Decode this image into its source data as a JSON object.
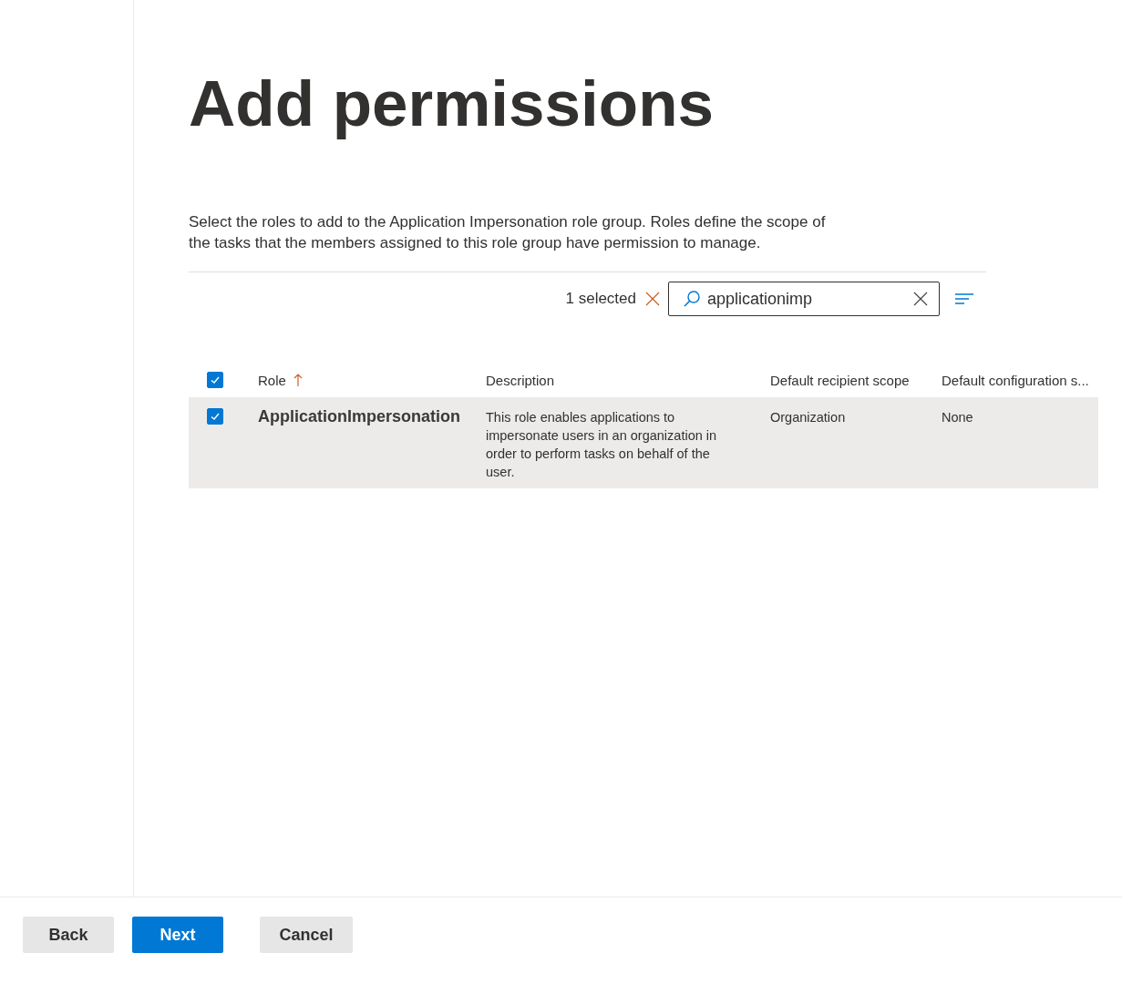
{
  "title": "Add permissions",
  "description": "Select the roles to add to the Application Impersonation role group. Roles define the scope of the tasks that the members assigned to this role group have permission to manage.",
  "toolbar": {
    "selection_count": "1 selected",
    "search": {
      "value": "applicationimp"
    }
  },
  "table": {
    "select_all": {
      "checked": true
    },
    "columns": [
      {
        "label": "Role",
        "sorted": true
      },
      {
        "label": "Description",
        "sorted": false
      },
      {
        "label": "Default recipient scope",
        "sorted": false
      },
      {
        "label": "Default configuration s...",
        "sorted": false
      }
    ],
    "rows": [
      {
        "selected": true,
        "checked": true,
        "cells": [
          "ApplicationImpersonation",
          "This role enables applications to impersonate users in an organization in order to perform tasks on behalf of the user.",
          "Organization",
          "None"
        ]
      }
    ]
  },
  "buttons": [
    {
      "label": "Back",
      "kind": "default"
    },
    {
      "label": "Next",
      "kind": "primary"
    },
    {
      "label": "Cancel",
      "kind": "default"
    }
  ]
}
